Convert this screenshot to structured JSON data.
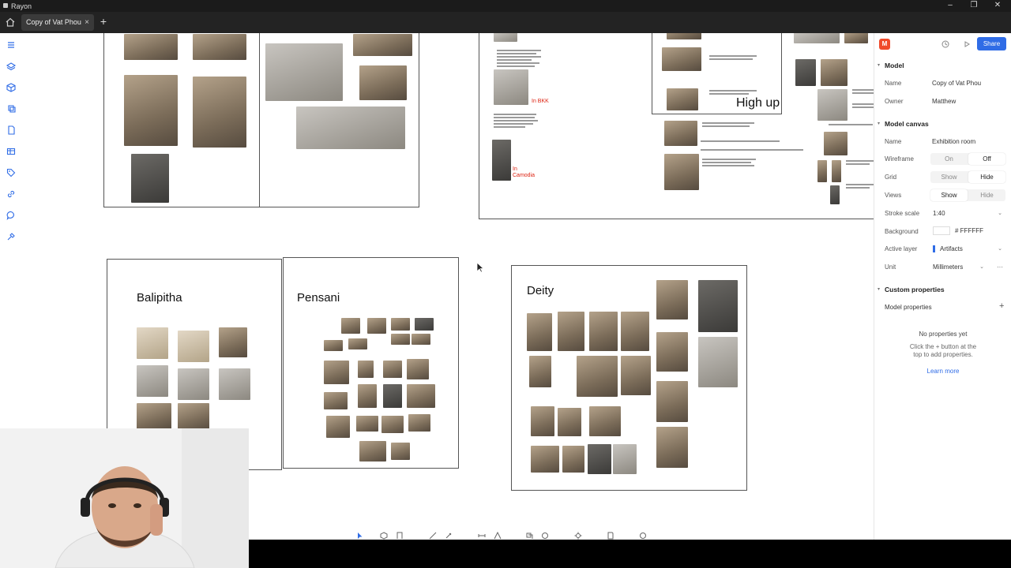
{
  "window": {
    "app_name": "Rayon"
  },
  "tabs": [
    {
      "label": "Copy of Vat Phou",
      "close": "×"
    }
  ],
  "new_tab": "+",
  "canvas": {
    "boards": {
      "balipitha": "Balipitha",
      "pensani": "Pensani",
      "deity": "Deity"
    },
    "labels": {
      "in_bkk": "In BKK",
      "in_cambodia": "In\nCamodia",
      "high_up": "High up"
    }
  },
  "panel": {
    "avatar": "M",
    "share": "Share",
    "model": {
      "heading": "Model",
      "name_label": "Name",
      "name_value": "Copy of Vat Phou",
      "owner_label": "Owner",
      "owner_value": "Matthew"
    },
    "model_canvas": {
      "heading": "Model canvas",
      "name_label": "Name",
      "name_value": "Exhibition room",
      "wireframe_label": "Wireframe",
      "wireframe_on": "On",
      "wireframe_off": "Off",
      "grid_label": "Grid",
      "grid_show": "Show",
      "grid_hide": "Hide",
      "views_label": "Views",
      "views_show": "Show",
      "views_hide": "Hide",
      "stroke_label": "Stroke scale",
      "stroke_value": "1:40",
      "background_label": "Background",
      "background_value": "# FFFFFF",
      "layer_label": "Active layer",
      "layer_value": "Artifacts",
      "unit_label": "Unit",
      "unit_value": "Millimeters",
      "more": "···"
    },
    "custom": {
      "heading": "Custom properties",
      "model_props": "Model properties",
      "add": "+",
      "empty_title": "No properties yet",
      "empty_line1": "Click the + button at the",
      "empty_line2": "top to add properties.",
      "learn_more": "Learn more"
    }
  },
  "colors": {
    "accent": "#2f6ce6",
    "avatar": "#f04a2a",
    "red_label": "#d21111"
  }
}
